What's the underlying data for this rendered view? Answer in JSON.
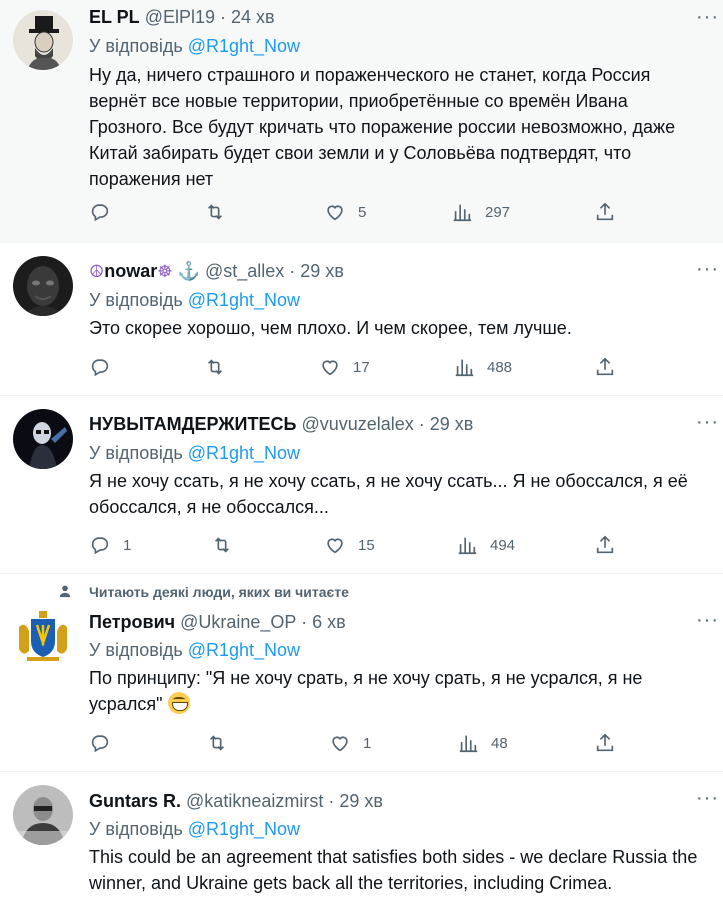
{
  "reply_prefix": "У відповідь",
  "reply_handle": "@R1ght_Now",
  "tweets": [
    {
      "name": "EL PL",
      "handle": "@ElPl19",
      "time": "· 24 хв",
      "text": "Ну да, ничего страшного и пораженческого не станет, когда Россия вернёт все новые территории, приобретённые со времён Ивана Грозного. Все будут кричать что поражение россии невозможно, даже Китай забирать будет свои земли и у Соловьёва подтвердят, что поражения нет",
      "likes": "5",
      "views": "297"
    },
    {
      "name_emoji_left": "☮",
      "name": "nowar",
      "name_emoji_right": "☸",
      "name_anchor": "⚓",
      "handle": "@st_allex",
      "time": "· 29 хв",
      "text": "Это скорее хорошо, чем плохо. И чем скорее, тем лучше.",
      "likes": "17",
      "views": "488"
    },
    {
      "name": "НУВЫТАМДЕРЖИТЕСЬ",
      "handle": "@vuvuzelalex",
      "time": "· 29 хв",
      "text": "Я не хочу ссать, я не хочу ссать, я не хочу ссать... Я не обоссался, я её обоссался, я не обоссался...",
      "replies": "1",
      "likes": "15",
      "views": "494"
    },
    {
      "social_context": "Читають деякі люди, яких ви читаєте",
      "name": "Петрович",
      "handle": "@Ukraine_OP",
      "time": "· 6 хв",
      "text": "По принципу: \"Я не хочу срать, я не хочу срать, я не усрался, я не усрался\"",
      "likes": "1",
      "views": "48"
    },
    {
      "name": "Guntars R.",
      "handle": "@katikneaizmirst",
      "time": "· 29 хв",
      "text": "This could be an agreement that satisfies both sides - we declare Russia the winner, and Ukraine gets back all the territories, including Crimea."
    }
  ],
  "icons": {
    "reply": "reply-icon",
    "retweet": "retweet-icon",
    "like": "like-icon",
    "views": "views-icon",
    "share": "share-icon",
    "more": "more-icon"
  },
  "colors": {
    "link": "#1d9bf0",
    "muted": "#536471",
    "highlight_bg": "#f7f9f9"
  }
}
